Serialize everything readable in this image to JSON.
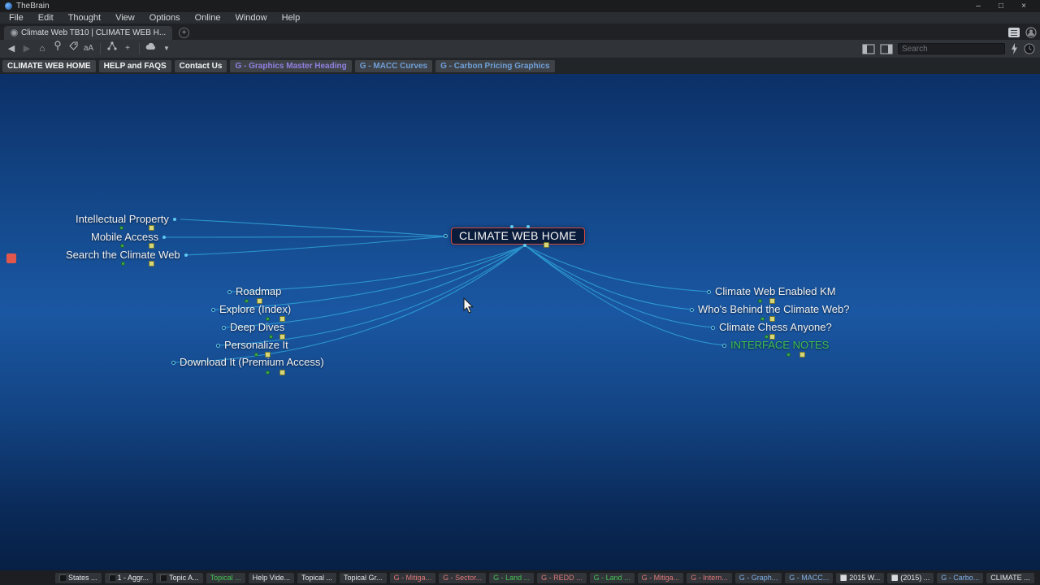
{
  "window": {
    "app_title": "TheBrain",
    "minimize": "–",
    "maximize": "□",
    "close": "×"
  },
  "menubar": {
    "items": [
      "File",
      "Edit",
      "Thought",
      "View",
      "Options",
      "Online",
      "Window",
      "Help"
    ]
  },
  "tabbar": {
    "tab_title": "Climate Web TB10 | CLIMATE WEB H...",
    "add_label": "+"
  },
  "toolbar": {
    "font_button": "aA",
    "zoom_plus": "+",
    "search_placeholder": "Search"
  },
  "shortcut_bar": {
    "items": [
      {
        "label": "CLIMATE WEB HOME",
        "color": "#f2f2f2"
      },
      {
        "label": "HELP and FAQS",
        "color": "#f2f2f2"
      },
      {
        "label": "Contact Us",
        "color": "#f2f2f2"
      },
      {
        "label": "G - Graphics Master Heading",
        "color": "#9080e0"
      },
      {
        "label": "G - MACC Curves",
        "color": "#6f9fd8"
      },
      {
        "label": "G - Carbon Pricing Graphics",
        "color": "#6f9fd8"
      }
    ]
  },
  "map": {
    "center": {
      "label": "CLIMATE WEB HOME"
    },
    "parents": [
      {
        "label": "Intellectual Property"
      },
      {
        "label": "Mobile Access"
      },
      {
        "label": "Search the Climate Web"
      }
    ],
    "left_children": [
      {
        "label": "Roadmap"
      },
      {
        "label": "Explore (Index)"
      },
      {
        "label": "Deep Dives"
      },
      {
        "label": "Personalize It"
      },
      {
        "label": "Download It (Premium Access)"
      }
    ],
    "right_children": [
      {
        "label": "Climate Web Enabled KM",
        "color": "#f2f2f2"
      },
      {
        "label": "Who's Behind the Climate Web?",
        "color": "#f2f2f2"
      },
      {
        "label": "Climate Chess Anyone?",
        "color": "#f2f2f2"
      },
      {
        "label": "INTERFACE NOTES",
        "color": "#3fbf4f"
      }
    ]
  },
  "bottombar": {
    "items": [
      {
        "label": "States ...",
        "color": "#e6e8ea"
      },
      {
        "label": "1 - Aggr...",
        "color": "#e6e8ea"
      },
      {
        "label": "Topic A...",
        "color": "#e6e8ea"
      },
      {
        "label": "Topical ...",
        "color": "#45c455"
      },
      {
        "label": "Help Vide...",
        "color": "#e6e8ea"
      },
      {
        "label": "Topical ...",
        "color": "#e6e8ea"
      },
      {
        "label": "Topical Gr...",
        "color": "#e6e8ea"
      },
      {
        "label": "G - Mitiga...",
        "color": "#e07a7a"
      },
      {
        "label": "G - Sector...",
        "color": "#e07a7a"
      },
      {
        "label": "G - Land ...",
        "color": "#45c455"
      },
      {
        "label": "G - REDD ...",
        "color": "#e07a7a"
      },
      {
        "label": "G - Land ...",
        "color": "#45c455"
      },
      {
        "label": "G - Mitiga...",
        "color": "#e07a7a"
      },
      {
        "label": "G - Intern...",
        "color": "#e07a7a"
      },
      {
        "label": "G - Graph...",
        "color": "#7fb0e8"
      },
      {
        "label": "G - MACC...",
        "color": "#7fb0e8"
      },
      {
        "label": "2015 W...",
        "color": "#e6e8ea"
      },
      {
        "label": "(2015) ...",
        "color": "#e6e8ea"
      },
      {
        "label": "G - Carbo...",
        "color": "#7fb0e8"
      },
      {
        "label": "CLIMATE ...",
        "color": "#e6e8ea"
      }
    ]
  },
  "colors": {
    "canvas_top": "#0c3067",
    "canvas_mid": "#1a57a2",
    "canvas_bottom": "#071f44",
    "link": "#2fa3d8",
    "accent": "#5fc9f2",
    "center_border": "#d4493e",
    "note_icon": "#d6d77a",
    "child_dot": "#3fae4e"
  }
}
